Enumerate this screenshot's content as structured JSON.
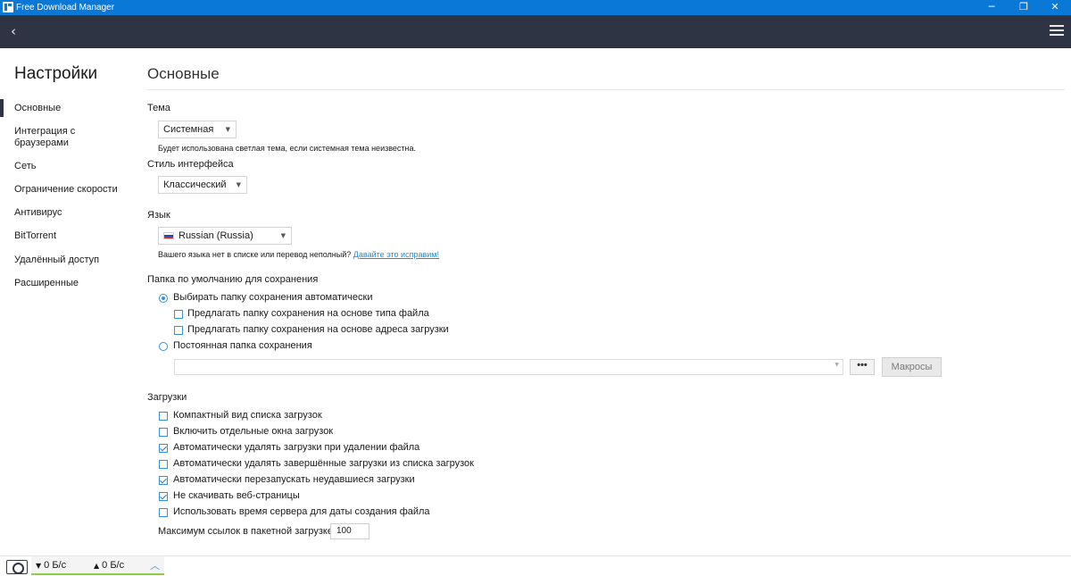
{
  "window": {
    "title": "Free Download Manager",
    "controls": {
      "minimize": "─",
      "maximize": "❐",
      "close": "✕"
    }
  },
  "toolbar": {
    "back_icon": "‹"
  },
  "sidebar": {
    "title": "Настройки",
    "items": [
      {
        "label": "Основные",
        "active": true
      },
      {
        "label": "Интеграция с браузерами"
      },
      {
        "label": "Сеть"
      },
      {
        "label": "Ограничение скорости"
      },
      {
        "label": "Антивирус"
      },
      {
        "label": "BitTorrent"
      },
      {
        "label": "Удалённый доступ"
      },
      {
        "label": "Расширенные"
      }
    ]
  },
  "main": {
    "title": "Основные",
    "theme": {
      "label": "Тема",
      "value": "Системная",
      "hint": "Будет использована светлая тема, если системная тема неизвестна."
    },
    "ui_style": {
      "label": "Стиль интерфейса",
      "value": "Классический"
    },
    "language": {
      "label": "Язык",
      "value": "Russian (Russia)",
      "hint": "Вашего языка нет в списке или перевод неполный?",
      "hint_link": "Давайте это исправим!"
    },
    "save_folder": {
      "label": "Папка по умолчанию для сохранения",
      "auto_radio": "Выбирать папку сохранения автоматически",
      "suggest_by_type": "Предлагать папку сохранения на основе типа файла",
      "suggest_by_url": "Предлагать папку сохранения на основе адреса загрузки",
      "fixed_radio": "Постоянная папка сохранения",
      "path_value": "",
      "browse_label": "•••",
      "macros_label": "Макросы"
    },
    "downloads": {
      "label": "Загрузки",
      "options": [
        {
          "label": "Компактный вид списка загрузок",
          "checked": false
        },
        {
          "label": "Включить отдельные окна загрузок",
          "checked": false
        },
        {
          "label": "Автоматически удалять загрузки при удалении файла",
          "checked": true
        },
        {
          "label": "Автоматически удалять завершённые загрузки из списка загрузок",
          "checked": false
        },
        {
          "label": "Автоматически перезапускать неудавшиеся загрузки",
          "checked": true
        },
        {
          "label": "Не скачивать веб-страницы",
          "checked": true
        },
        {
          "label": "Использовать время сервера для даты создания файла",
          "checked": false
        }
      ],
      "max_links_label": "Максимум ссылок в пакетной загрузке",
      "max_links_value": "100"
    }
  },
  "statusbar": {
    "download_speed": "0 Б/с",
    "upload_speed": "0 Б/с",
    "down_icon": "▼",
    "up_icon": "▲",
    "expand_icon": "︿"
  }
}
